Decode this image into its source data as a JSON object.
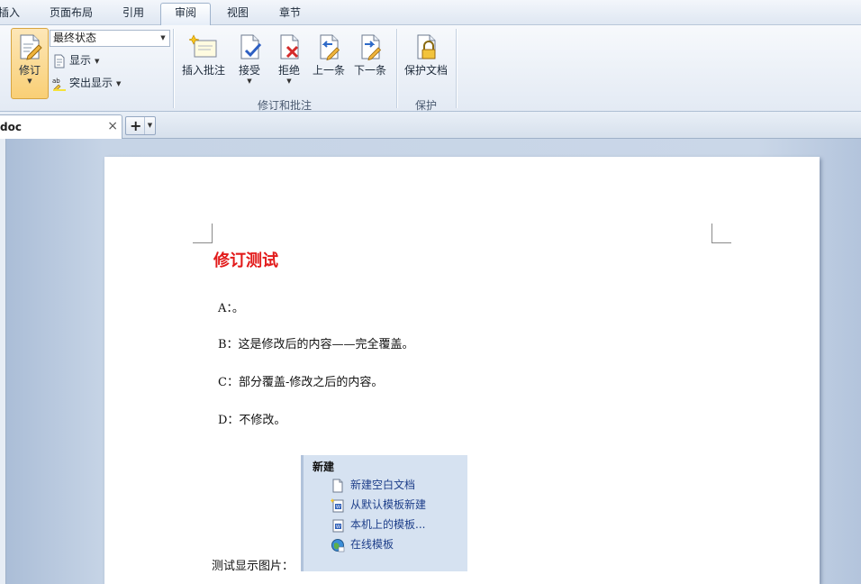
{
  "menu": {
    "tabs": [
      "插入",
      "页面布局",
      "引用",
      "审阅",
      "视图",
      "章节"
    ],
    "active": "审阅"
  },
  "ribbon": {
    "track_changes_label": "修订",
    "final_state_value": "最终状态",
    "show_label": "显示",
    "highlight_label": "突出显示",
    "insert_comment_label": "插入批注",
    "accept_label": "接受",
    "reject_label": "拒绝",
    "previous_label": "上一条",
    "next_label": "下一条",
    "protect_doc_label": "保护文档",
    "group_revisions_label": "修订和批注",
    "group_protect_label": "保护"
  },
  "doc_tabs": {
    "current_name": "doc",
    "close_glyph": "×",
    "new_tab_glyph": "+"
  },
  "document": {
    "title": "修订测试",
    "paragraphs": {
      "a": "A：。",
      "b": "B：这是修改后的内容——完全覆盖。",
      "c": "C：部分覆盖-修改之后的内容。",
      "d": "D：不修改。"
    },
    "image_label": "测试显示图片："
  },
  "embedded_panel": {
    "title": "新建",
    "items": [
      "新建空白文档",
      "从默认模板新建",
      "本机上的模板...",
      "在线模板"
    ]
  },
  "colors": {
    "title_red": "#e21b1b",
    "link_blue": "#1e3f8a",
    "pressed_orange": "#f9cf75"
  }
}
